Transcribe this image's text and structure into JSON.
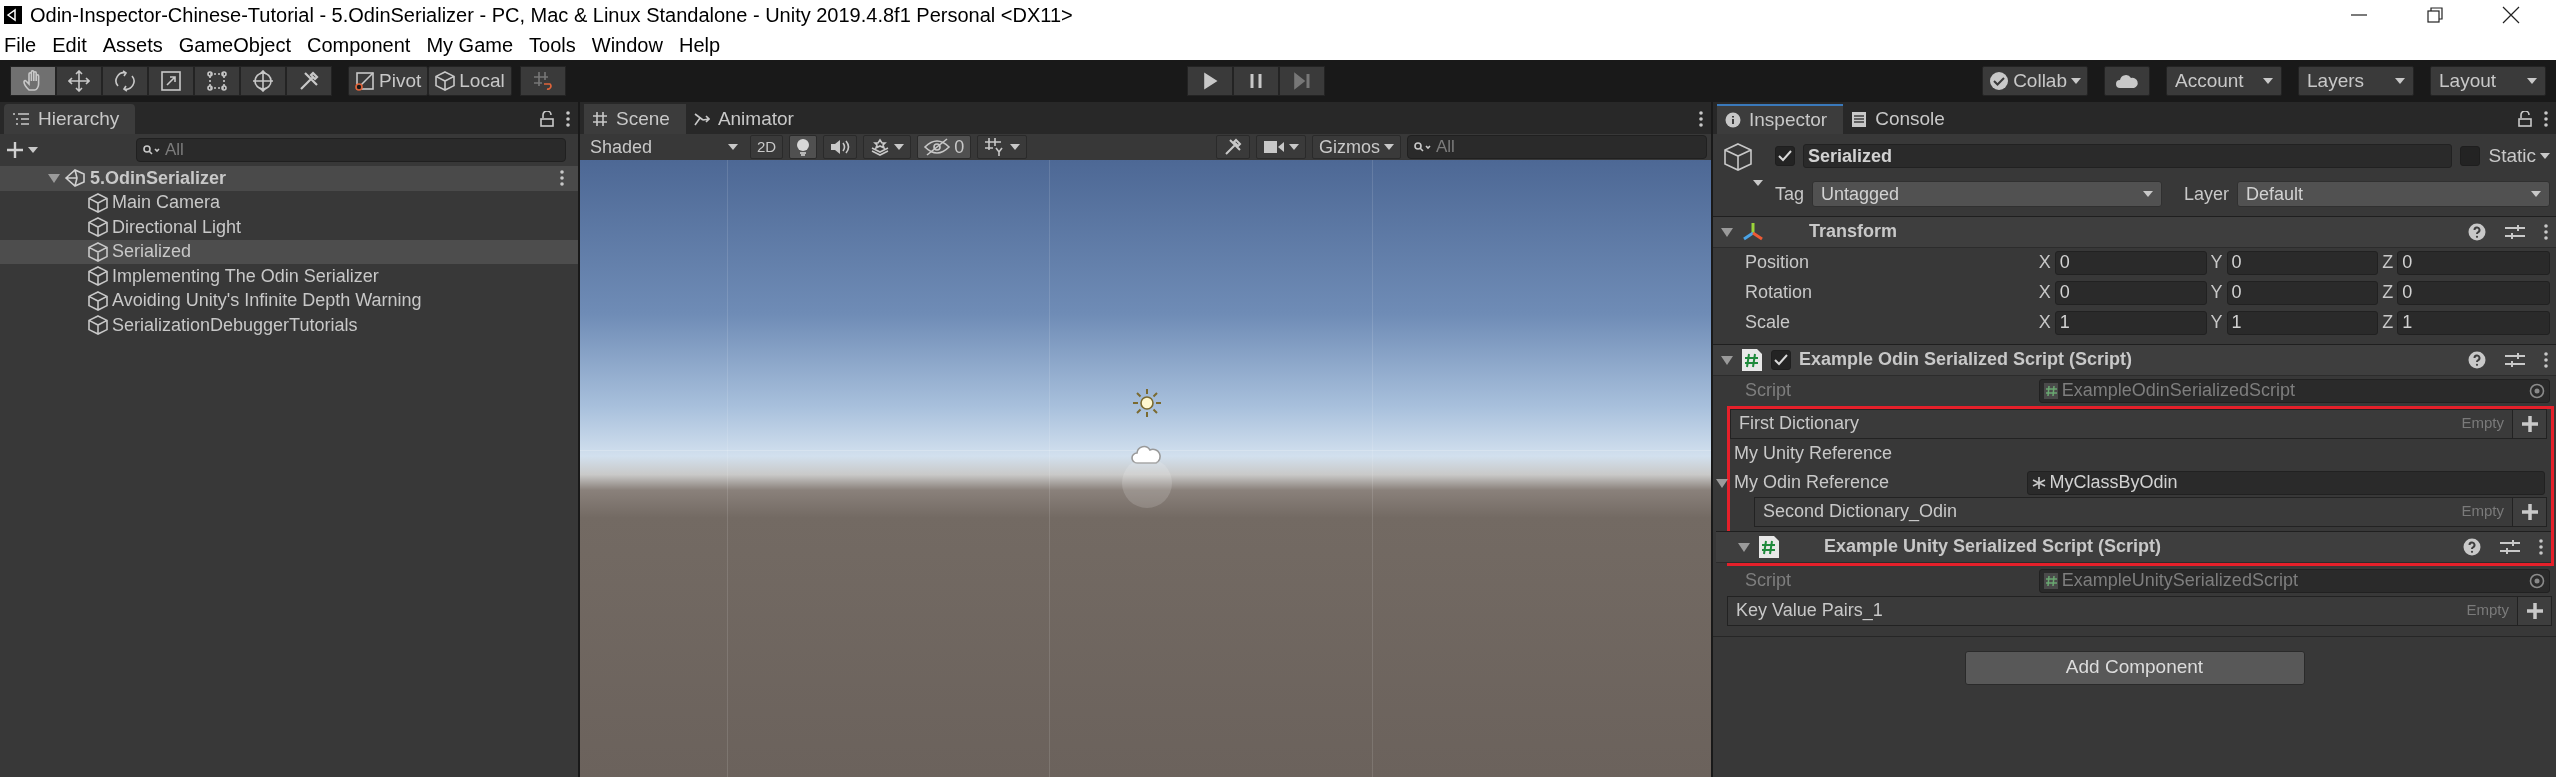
{
  "window": {
    "title": "Odin-Inspector-Chinese-Tutorial - 5.OdinSerializer - PC, Mac & Linux Standalone - Unity 2019.4.8f1 Personal <DX11>"
  },
  "menu": [
    "File",
    "Edit",
    "Assets",
    "GameObject",
    "Component",
    "My Game",
    "Tools",
    "Window",
    "Help"
  ],
  "toolbar": {
    "tools": [
      {
        "kind": "hand",
        "selected": true
      },
      {
        "kind": "move",
        "selected": false
      },
      {
        "kind": "rotate",
        "selected": false
      },
      {
        "kind": "scale",
        "selected": false
      },
      {
        "kind": "rect",
        "selected": false
      },
      {
        "kind": "transform",
        "selected": false
      },
      {
        "kind": "custom",
        "selected": false
      }
    ],
    "pivot": "Pivot",
    "space": "Local",
    "collab": "Collab",
    "account": "Account",
    "layers": "Layers",
    "layout": "Layout"
  },
  "hierarchy": {
    "tab": "Hierarchy",
    "search_placeholder": "All",
    "scene": {
      "name": "5.OdinSerializer",
      "expanded": true,
      "children": [
        {
          "name": "Main Camera",
          "selected": false
        },
        {
          "name": "Directional Light",
          "selected": false
        },
        {
          "name": "Serialized",
          "selected": true
        },
        {
          "name": "Implementing The Odin Serializer",
          "selected": false
        },
        {
          "name": "Avoiding Unity's Infinite Depth Warning",
          "selected": false
        },
        {
          "name": "SerializationDebuggerTutorials",
          "selected": false
        }
      ]
    }
  },
  "scene_view": {
    "tabs": [
      {
        "label": "Scene",
        "kind": "scene",
        "selected": true
      },
      {
        "label": "Animator",
        "kind": "animator",
        "selected": false
      }
    ],
    "shading": "Shaded",
    "mode_2d": "2D",
    "lighting": true,
    "hidden_count": "0",
    "gizmos": "Gizmos",
    "search_placeholder": "All"
  },
  "inspector": {
    "tabs": [
      {
        "label": "Inspector",
        "kind": "info",
        "selected": true
      },
      {
        "label": "Console",
        "kind": "console",
        "selected": false
      }
    ],
    "object": {
      "active": true,
      "name": "Serialized",
      "static": false,
      "static_label": "Static",
      "tag_label": "Tag",
      "tag": "Untagged",
      "layer_label": "Layer",
      "layer": "Default"
    },
    "rows": [
      {
        "kind": "transform-header",
        "title": "Transform",
        "expanded": true,
        "highlighted": false
      },
      {
        "kind": "vector3",
        "label": "Position",
        "values": [
          {
            "axis": "X",
            "value": "0"
          },
          {
            "axis": "Y",
            "value": "0"
          },
          {
            "axis": "Z",
            "value": "0"
          }
        ],
        "highlighted": false
      },
      {
        "kind": "vector3",
        "label": "Rotation",
        "values": [
          {
            "axis": "X",
            "value": "0"
          },
          {
            "axis": "Y",
            "value": "0"
          },
          {
            "axis": "Z",
            "value": "0"
          }
        ],
        "highlighted": false
      },
      {
        "kind": "vector3",
        "label": "Scale",
        "values": [
          {
            "axis": "X",
            "value": "1"
          },
          {
            "axis": "Y",
            "value": "1"
          },
          {
            "axis": "Z",
            "value": "1"
          }
        ],
        "highlighted": false
      },
      {
        "kind": "script-header",
        "title": "Example Odin Serialized Script (Script)",
        "enabled": true,
        "expanded": true,
        "highlighted": false
      },
      {
        "kind": "script",
        "label": "Script",
        "value": "ExampleOdinSerializedScript",
        "disabled": true,
        "highlighted": false
      },
      {
        "kind": "dictionary",
        "label": "First Dictionary",
        "status": "Empty",
        "highlighted": true
      },
      {
        "kind": "label",
        "label": "My Unity Reference",
        "highlighted": true
      },
      {
        "kind": "reference",
        "label": "My Odin Reference",
        "value": "MyClassByOdin",
        "expanded": true,
        "highlighted": true,
        "children": [
          {
            "kind": "dictionary",
            "label": "Second Dictionary_Odin",
            "status": "Empty"
          }
        ]
      },
      {
        "kind": "script-header",
        "title": "Example Unity Serialized Script (Script)",
        "expanded": true,
        "highlighted": true
      },
      {
        "kind": "script",
        "label": "Script",
        "value": "ExampleUnitySerializedScript",
        "disabled": true,
        "highlighted": false
      },
      {
        "kind": "dictionary",
        "label": "Key Value Pairs_1",
        "status": "Empty",
        "highlighted": false
      }
    ],
    "add_component": "Add Component"
  }
}
